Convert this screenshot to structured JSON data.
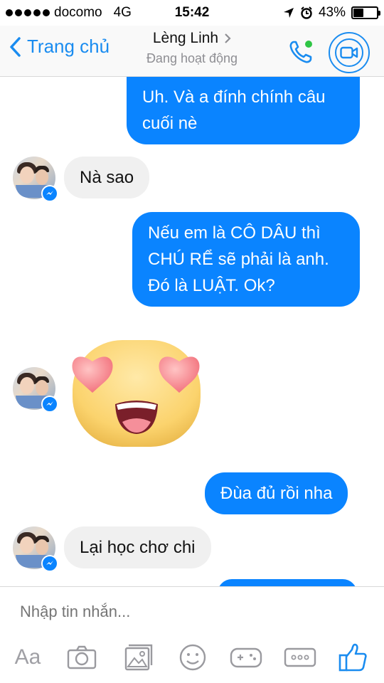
{
  "status_bar": {
    "carrier": "docomo",
    "network": "4G",
    "time": "15:42",
    "battery": "43%",
    "battery_level": 0.43
  },
  "nav": {
    "back_label": "Trang chủ",
    "contact_name": "Lèng Linh",
    "contact_status": "Đang hoạt động",
    "accent_color": "#1a8cf0"
  },
  "messages": [
    {
      "direction": "outgoing",
      "text": "Uh. Và a đính chính câu cuối nè"
    },
    {
      "direction": "incoming",
      "text": "Nà sao"
    },
    {
      "direction": "outgoing",
      "text": "Nếu em là CÔ DÂU thì CHÚ RỂ sẽ phải là anh. Đó là LUẬT. Ok?"
    },
    {
      "direction": "incoming",
      "sticker": "heart-eyes-emoji"
    },
    {
      "direction": "outgoing",
      "text": "Đùa đủ rồi nha"
    },
    {
      "direction": "incoming",
      "text": "Lại học chơ chi"
    }
  ],
  "composer": {
    "placeholder": "Nhập tin nhắn...",
    "text_format_label": "Aa",
    "tools": [
      "text-format-icon",
      "camera-icon",
      "gallery-icon",
      "emoji-icon",
      "game-controller-icon",
      "more-icon",
      "thumbs-up-icon"
    ]
  },
  "colors": {
    "outgoing_bubble": "#0a84ff",
    "incoming_bubble": "#f0f0f0",
    "active_dot": "#2fc545"
  }
}
